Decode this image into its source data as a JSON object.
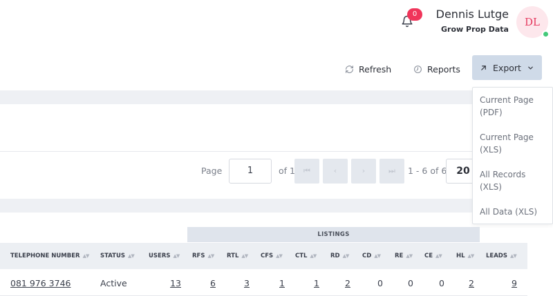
{
  "header": {
    "notifications_count": "0",
    "user_name": "Dennis Lutge",
    "org_name": "Grow Prop Data",
    "avatar_initials": "DL",
    "status_color": "#44c97a"
  },
  "toolbar": {
    "refresh_label": "Refresh",
    "reports_label": "Reports",
    "export_label": "Export",
    "icons": [
      "refresh-icon",
      "clock-icon",
      "arrow-up-right-icon",
      "chevron-down-icon"
    ]
  },
  "export_menu": {
    "items": [
      "Current Page (PDF)",
      "Current Page (XLS)",
      "All Records (XLS)",
      "All Data (XLS)"
    ]
  },
  "pagination": {
    "page_label": "Page",
    "current_page": "1",
    "of_label": "of 1",
    "first_glyph": "⏮",
    "prev_glyph": "‹",
    "next_glyph": "›",
    "last_glyph": "⏭",
    "range_text": "1 - 6 of 6",
    "page_size": "20"
  },
  "table": {
    "group_header": "LISTINGS",
    "columns": [
      "TELEPHONE NUMBER",
      "STATUS",
      "USERS",
      "RFS",
      "RTL",
      "CFS",
      "CTL",
      "RD",
      "CD",
      "RE",
      "CE",
      "HL",
      "LEADS"
    ],
    "rows": [
      [
        "081 976 3746",
        "Active",
        "13",
        "6",
        "3",
        "1",
        "1",
        "2",
        "0",
        "0",
        "0",
        "2",
        "9"
      ]
    ]
  },
  "colors": {
    "accent_badge": "#f0355a",
    "export_button": "#cfdae8",
    "page_background": "#eef0f4"
  }
}
